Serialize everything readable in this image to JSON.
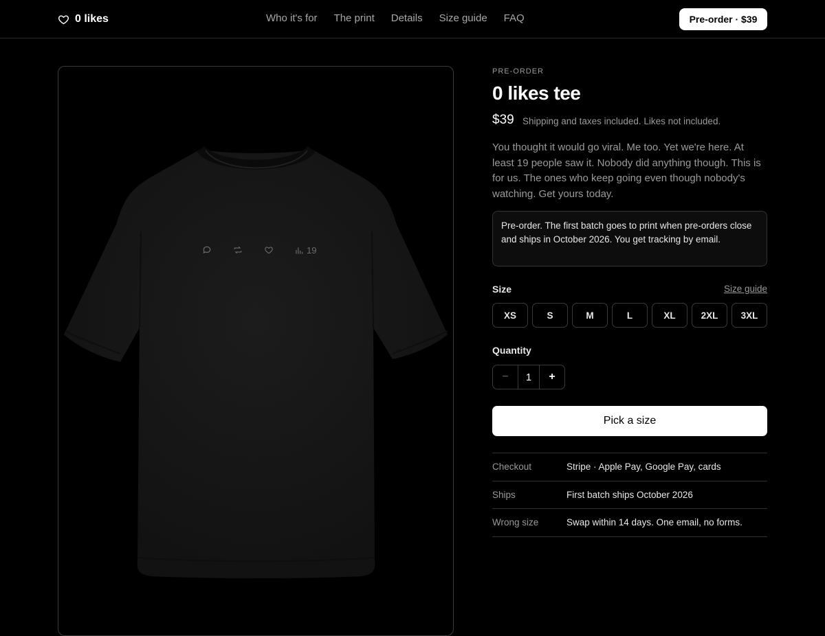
{
  "nav": {
    "brand": "0 likes",
    "links": [
      "Who it's for",
      "The print",
      "Details",
      "Size guide",
      "FAQ"
    ],
    "cta": "Pre-order · $39"
  },
  "product": {
    "eyebrow": "PRE-ORDER",
    "title": "0 likes tee",
    "price": "$39",
    "price_note": "Shipping and taxes included. Likes not included.",
    "description": "You thought it would go viral. Me too. Yet we're here. At least 19 people saw it. Nobody did anything though. This is for us. The ones who keep going even though nobody's watching. Get yours today.",
    "notice": "Pre-order. The first batch goes to print when pre-orders close and ships in October 2026. You get tracking by email.",
    "print_views": "19",
    "shirt_color": "#161616"
  },
  "size": {
    "label": "Size",
    "guide_link": "Size guide",
    "options": [
      "XS",
      "S",
      "M",
      "L",
      "XL",
      "2XL",
      "3XL"
    ]
  },
  "quantity": {
    "label": "Quantity",
    "value": "1",
    "minus": "−",
    "plus": "+"
  },
  "cta": "Pick a size",
  "info": [
    {
      "key": "Checkout",
      "value": "Stripe · Apple Pay, Google Pay, cards"
    },
    {
      "key": "Ships",
      "value": "First batch ships October 2026"
    },
    {
      "key": "Wrong size",
      "value": "Swap within 14 days. One email, no forms."
    }
  ]
}
